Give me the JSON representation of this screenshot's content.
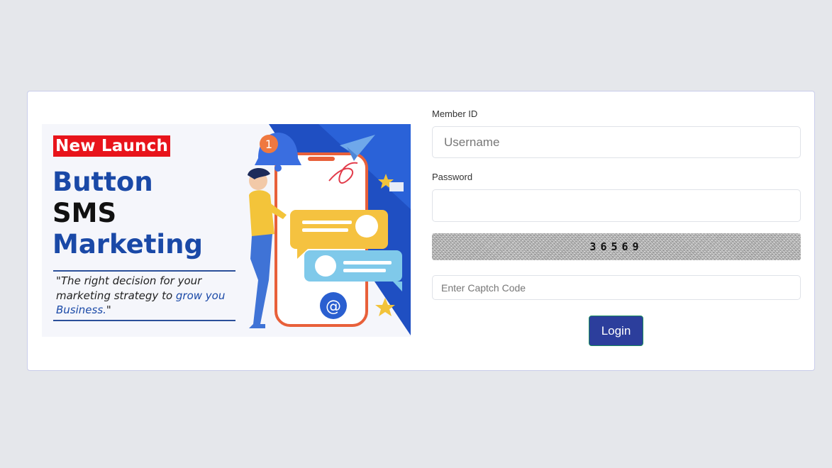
{
  "banner": {
    "badge": "New Launch",
    "headline_1": "Button",
    "headline_2": "SMS",
    "headline_3": "Marketing",
    "quote_part1": "\"The right decision for your marketing strategy to ",
    "quote_highlight": "grow you Business.",
    "quote_end": "\"",
    "notification_count": "1",
    "at_symbol": "@"
  },
  "form": {
    "member_label": "Member ID",
    "username_placeholder": "Username",
    "password_label": "Password",
    "captcha_code": "36569",
    "captcha_placeholder": "Enter Captch Code",
    "login_label": "Login"
  },
  "colors": {
    "brand_blue": "#1a49a7",
    "badge_red": "#e8141b",
    "button_bg": "#2c3e9c",
    "page_bg": "#e5e7eb"
  }
}
